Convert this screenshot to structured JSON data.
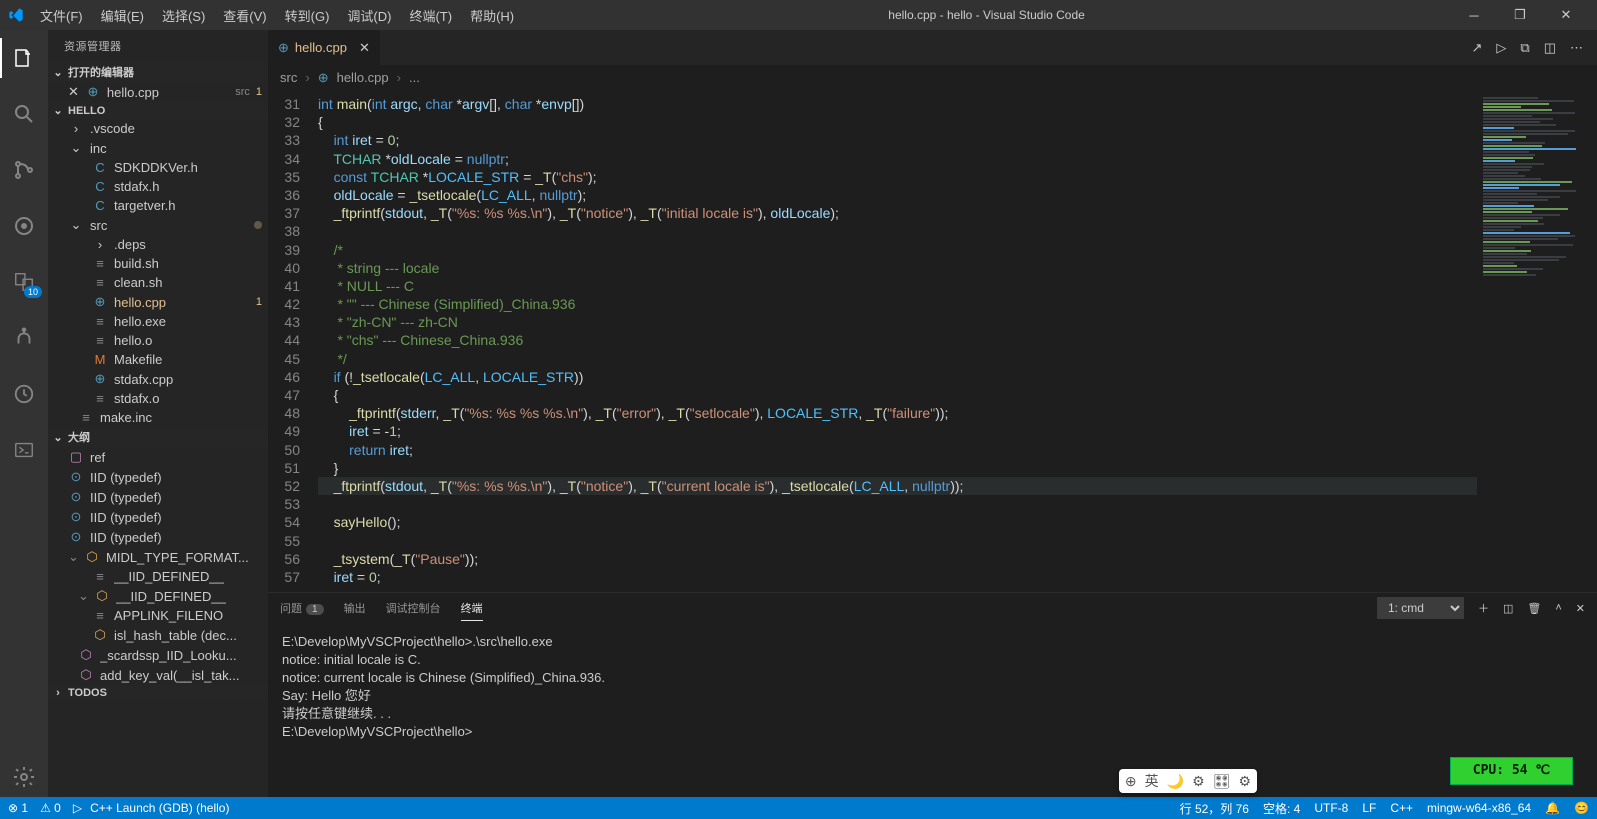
{
  "window": {
    "title": "hello.cpp - hello - Visual Studio Code"
  },
  "menu": [
    "文件(F)",
    "编辑(E)",
    "选择(S)",
    "查看(V)",
    "转到(G)",
    "调试(D)",
    "终端(T)",
    "帮助(H)"
  ],
  "sidebar": {
    "title": "资源管理器",
    "open_editors": {
      "head": "打开的编辑器",
      "items": [
        {
          "label": "hello.cpp",
          "tag": "src",
          "mark": "1"
        }
      ]
    },
    "project": "HELLO",
    "tree": [
      {
        "type": "folder",
        "label": ".vscode",
        "open": false
      },
      {
        "type": "folder",
        "label": "inc",
        "open": true
      },
      {
        "type": "file",
        "label": "SDKDDKVer.h",
        "icon": "C",
        "color": "#519aba",
        "indent": 2
      },
      {
        "type": "file",
        "label": "stdafx.h",
        "icon": "C",
        "color": "#519aba",
        "indent": 2
      },
      {
        "type": "file",
        "label": "targetver.h",
        "icon": "C",
        "color": "#519aba",
        "indent": 2
      },
      {
        "type": "folder",
        "label": "src",
        "open": true,
        "dot": true
      },
      {
        "type": "folder",
        "label": ".deps",
        "open": false,
        "indent": 2
      },
      {
        "type": "file",
        "label": "build.sh",
        "icon": "≡",
        "color": "#888",
        "indent": 2
      },
      {
        "type": "file",
        "label": "clean.sh",
        "icon": "≡",
        "color": "#888",
        "indent": 2
      },
      {
        "type": "file",
        "label": "hello.cpp",
        "icon": "⊕",
        "color": "#519aba",
        "indent": 2,
        "sel": true,
        "mark": "1"
      },
      {
        "type": "file",
        "label": "hello.exe",
        "icon": "≡",
        "color": "#888",
        "indent": 2
      },
      {
        "type": "file",
        "label": "hello.o",
        "icon": "≡",
        "color": "#888",
        "indent": 2
      },
      {
        "type": "file",
        "label": "Makefile",
        "icon": "M",
        "color": "#e37933",
        "indent": 2
      },
      {
        "type": "file",
        "label": "stdafx.cpp",
        "icon": "⊕",
        "color": "#519aba",
        "indent": 2
      },
      {
        "type": "file",
        "label": "stdafx.o",
        "icon": "≡",
        "color": "#888",
        "indent": 2
      },
      {
        "type": "file",
        "label": "make.inc",
        "icon": "≡",
        "color": "#888",
        "indent": 1
      }
    ],
    "outline": {
      "head": "大纲",
      "items": [
        {
          "icon": "▢",
          "label": "ref",
          "color": "#c586c0"
        },
        {
          "icon": "⊙",
          "label": "IID (typedef)",
          "color": "#519aba"
        },
        {
          "icon": "⊙",
          "label": "IID (typedef)",
          "color": "#519aba"
        },
        {
          "icon": "⊙",
          "label": "IID (typedef)",
          "color": "#519aba"
        },
        {
          "icon": "⊙",
          "label": "IID (typedef)",
          "color": "#519aba"
        },
        {
          "icon": "⬡",
          "label": "MIDL_TYPE_FORMAT...",
          "color": "#e8ab53",
          "expand": true
        },
        {
          "icon": "≡",
          "label": "__IID_DEFINED__",
          "color": "#888",
          "indent": 2
        },
        {
          "icon": "⬡",
          "label": "__IID_DEFINED__",
          "color": "#e8ab53",
          "indent": 1,
          "expand": true
        },
        {
          "icon": "≡",
          "label": "APPLINK_FILENO",
          "color": "#888",
          "indent": 2
        },
        {
          "icon": "⬡",
          "label": "isl_hash_table (dec...",
          "color": "#e8ab53",
          "indent": 2
        },
        {
          "icon": "⬡",
          "label": "_scardssp_IID_Looku...",
          "color": "#c586c0",
          "indent": 1
        },
        {
          "icon": "⬡",
          "label": "add_key_val(__isl_tak...",
          "color": "#c586c0",
          "indent": 1
        }
      ],
      "todos": "TODOS"
    }
  },
  "tabs": {
    "name": "hello.cpp"
  },
  "crumb": [
    "src",
    "hello.cpp",
    "..."
  ],
  "panel": {
    "tabs": [
      "问题",
      "输出",
      "调试控制台",
      "终端"
    ],
    "active": 3,
    "problem_count": "1",
    "term_select": "1: cmd",
    "lines": [
      "E:\\Develop\\MyVSCProject\\hello>.\\src\\hello.exe",
      "notice: initial locale is C.",
      "notice: current locale is Chinese (Simplified)_China.936.",
      "Say: Hello 您好",
      "请按任意键继续. . .",
      "",
      "E:\\Develop\\MyVSCProject\\hello>"
    ],
    "cpu": "CPU: 54 ℃"
  },
  "status": {
    "left": [
      "⊗ 1",
      "⚠ 0",
      "C++ Launch (GDB) (hello)"
    ],
    "right": [
      "行 52，列 76",
      "空格: 4",
      "UTF-8",
      "LF",
      "C++",
      "mingw-w64-x86_64",
      "🔔",
      "😊"
    ]
  },
  "ime": [
    "⊕",
    "英",
    "🌙",
    "⚙",
    "🎛",
    "⚙"
  ]
}
